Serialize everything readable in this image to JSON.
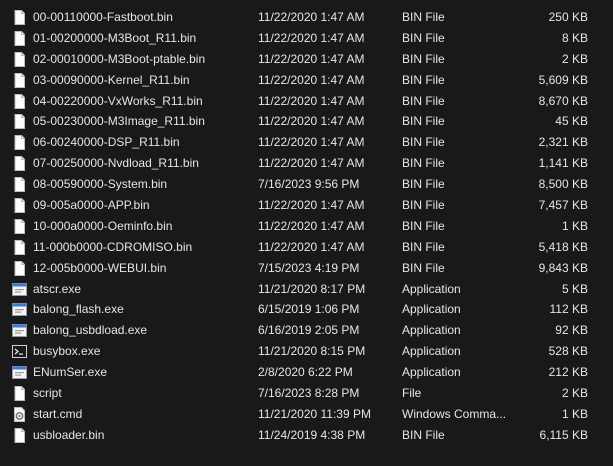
{
  "files": [
    {
      "name": "00-00110000-Fastboot.bin",
      "date": "11/22/2020 1:47 AM",
      "type": "BIN File",
      "size": "250 KB",
      "icon": "file-icon"
    },
    {
      "name": "01-00200000-M3Boot_R11.bin",
      "date": "11/22/2020 1:47 AM",
      "type": "BIN File",
      "size": "8 KB",
      "icon": "file-icon"
    },
    {
      "name": "02-00010000-M3Boot-ptable.bin",
      "date": "11/22/2020 1:47 AM",
      "type": "BIN File",
      "size": "2 KB",
      "icon": "file-icon"
    },
    {
      "name": "03-00090000-Kernel_R11.bin",
      "date": "11/22/2020 1:47 AM",
      "type": "BIN File",
      "size": "5,609 KB",
      "icon": "file-icon"
    },
    {
      "name": "04-00220000-VxWorks_R11.bin",
      "date": "11/22/2020 1:47 AM",
      "type": "BIN File",
      "size": "8,670 KB",
      "icon": "file-icon"
    },
    {
      "name": "05-00230000-M3Image_R11.bin",
      "date": "11/22/2020 1:47 AM",
      "type": "BIN File",
      "size": "45 KB",
      "icon": "file-icon"
    },
    {
      "name": "06-00240000-DSP_R11.bin",
      "date": "11/22/2020 1:47 AM",
      "type": "BIN File",
      "size": "2,321 KB",
      "icon": "file-icon"
    },
    {
      "name": "07-00250000-Nvdload_R11.bin",
      "date": "11/22/2020 1:47 AM",
      "type": "BIN File",
      "size": "1,141 KB",
      "icon": "file-icon"
    },
    {
      "name": "08-00590000-System.bin",
      "date": "7/16/2023 9:56 PM",
      "type": "BIN File",
      "size": "8,500 KB",
      "icon": "file-icon"
    },
    {
      "name": "09-005a0000-APP.bin",
      "date": "11/22/2020 1:47 AM",
      "type": "BIN File",
      "size": "7,457 KB",
      "icon": "file-icon"
    },
    {
      "name": "10-000a0000-Oeminfo.bin",
      "date": "11/22/2020 1:47 AM",
      "type": "BIN File",
      "size": "1 KB",
      "icon": "file-icon"
    },
    {
      "name": "11-000b0000-CDROMISO.bin",
      "date": "11/22/2020 1:47 AM",
      "type": "BIN File",
      "size": "5,418 KB",
      "icon": "file-icon"
    },
    {
      "name": "12-005b0000-WEBUI.bin",
      "date": "7/15/2023 4:19 PM",
      "type": "BIN File",
      "size": "9,843 KB",
      "icon": "file-icon"
    },
    {
      "name": "atscr.exe",
      "date": "11/21/2020 8:17 PM",
      "type": "Application",
      "size": "5 KB",
      "icon": "app-icon"
    },
    {
      "name": "balong_flash.exe",
      "date": "6/15/2019 1:06 PM",
      "type": "Application",
      "size": "112 KB",
      "icon": "app-icon"
    },
    {
      "name": "balong_usbdload.exe",
      "date": "6/16/2019 2:05 PM",
      "type": "Application",
      "size": "92 KB",
      "icon": "app-icon"
    },
    {
      "name": "busybox.exe",
      "date": "11/21/2020 8:15 PM",
      "type": "Application",
      "size": "528 KB",
      "icon": "console-icon"
    },
    {
      "name": "ENumSer.exe",
      "date": "2/8/2020 6:22 PM",
      "type": "Application",
      "size": "212 KB",
      "icon": "app-icon"
    },
    {
      "name": "script",
      "date": "7/16/2023 8:28 PM",
      "type": "File",
      "size": "2 KB",
      "icon": "file-icon"
    },
    {
      "name": "start.cmd",
      "date": "11/21/2020 11:39 PM",
      "type": "Windows Comma...",
      "size": "1 KB",
      "icon": "gear-file-icon"
    },
    {
      "name": "usbloader.bin",
      "date": "11/24/2019 4:38 PM",
      "type": "BIN File",
      "size": "6,115 KB",
      "icon": "file-icon"
    }
  ]
}
